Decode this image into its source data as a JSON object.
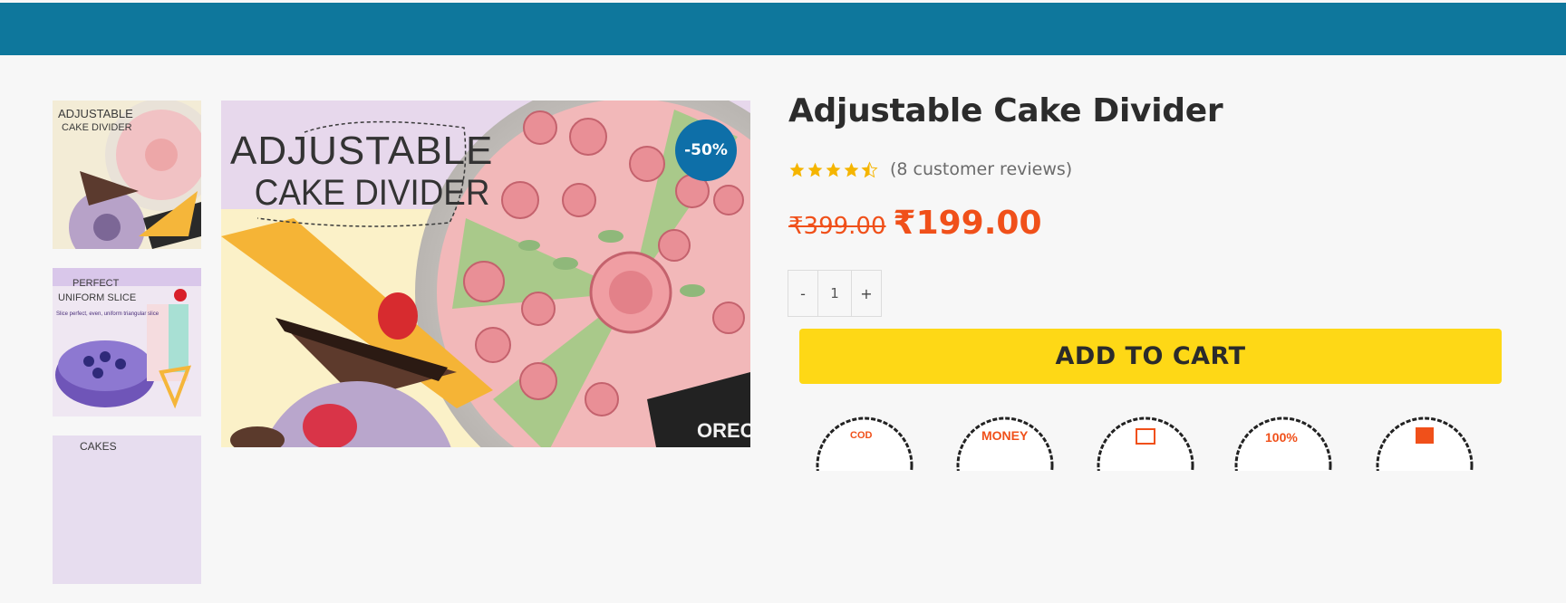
{
  "product": {
    "title": "Adjustable Cake Divider",
    "rating": 4.5,
    "rating_max": 5,
    "review_text": "(8 customer reviews)",
    "old_price": "₹399.00",
    "new_price": "₹199.00",
    "sale_badge": "-50%"
  },
  "quantity": {
    "minus_label": "-",
    "value": "1",
    "plus_label": "+"
  },
  "cart": {
    "button_label": "ADD TO CART"
  },
  "images": {
    "main_heading_line1": "ADJUSTABLE",
    "main_heading_line2": "CAKE DIVIDER",
    "thumb1_line1": "ADJUSTABLE",
    "thumb1_line2": "CAKE DIVIDER",
    "thumb2_line1": "PERFECT",
    "thumb2_line2": "UNIFORM SLICE",
    "thumb2_caption": "Slice perfect, even, uniform triangular slice",
    "thumb3_partial": "CAKES"
  },
  "trust_badges": [
    "COD",
    "MONEY",
    "",
    "100%",
    ""
  ],
  "colors": {
    "topbar": "#0e779c",
    "accent_price": "#f0501a",
    "cart_button": "#fed816",
    "sale_badge": "#0e6fa8",
    "star": "#f5b500"
  }
}
